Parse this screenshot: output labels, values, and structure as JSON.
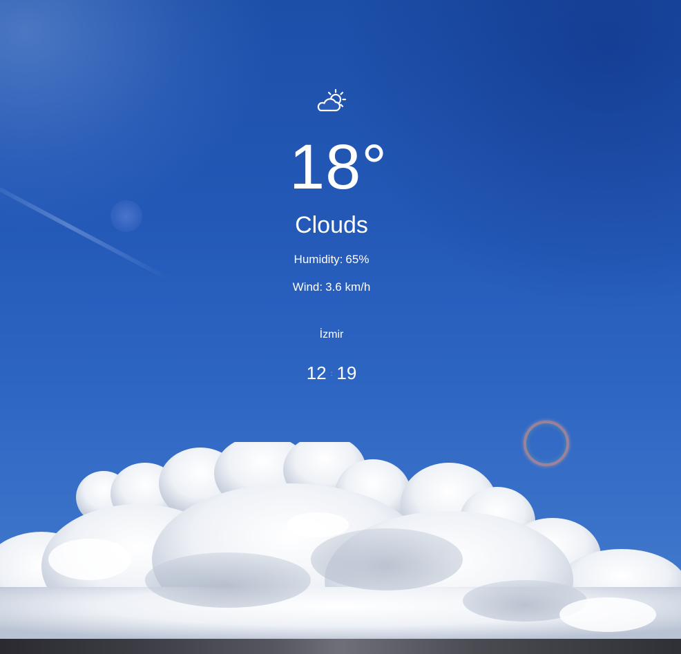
{
  "weather": {
    "icon": "partly-cloudy-icon",
    "temperature": "18°",
    "condition": "Clouds",
    "humidity_label": "Humidity:",
    "humidity_value": "65%",
    "wind_label": "Wind:",
    "wind_value": "3.6 km/h"
  },
  "location": {
    "city": "İzmir"
  },
  "clock": {
    "hours": "12",
    "separator": ":",
    "minutes": "19"
  },
  "colors": {
    "text": "#ffffff",
    "sky_top": "#1c4fa8",
    "sky_bottom": "#4a80cf"
  }
}
